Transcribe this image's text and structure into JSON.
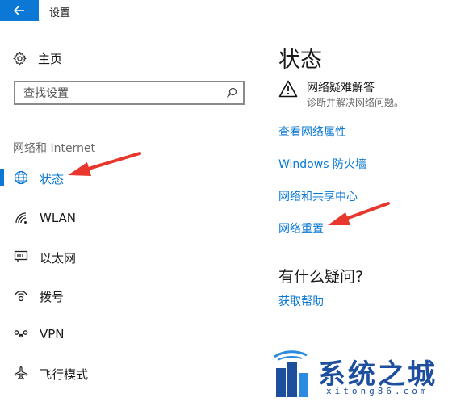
{
  "window": {
    "title": "设置"
  },
  "sidebar": {
    "home_label": "主页",
    "search_placeholder": "查找设置",
    "section_heading": "网络和 Internet",
    "items": [
      {
        "label": "状态",
        "icon": "globe-icon",
        "active": true
      },
      {
        "label": "WLAN",
        "icon": "wifi-icon",
        "active": false
      },
      {
        "label": "以太网",
        "icon": "ethernet-icon",
        "active": false
      },
      {
        "label": "拨号",
        "icon": "dialup-icon",
        "active": false
      },
      {
        "label": "VPN",
        "icon": "vpn-icon",
        "active": false
      },
      {
        "label": "飞行模式",
        "icon": "airplane-icon",
        "active": false
      }
    ]
  },
  "main": {
    "title": "状态",
    "troubleshoot": {
      "title": "网络疑难解答",
      "subtitle": "诊断并解决网络问题。"
    },
    "links": [
      "查看网络属性",
      "Windows 防火墙",
      "网络和共享中心",
      "网络重置"
    ],
    "question": "有什么疑问?",
    "help_link": "获取帮助"
  },
  "watermark": {
    "text": "系统之城",
    "url": "xitong86.com"
  },
  "colors": {
    "accent": "#0a78d4",
    "arrow": "#e8372d",
    "watermark": "#1d4f9e"
  }
}
